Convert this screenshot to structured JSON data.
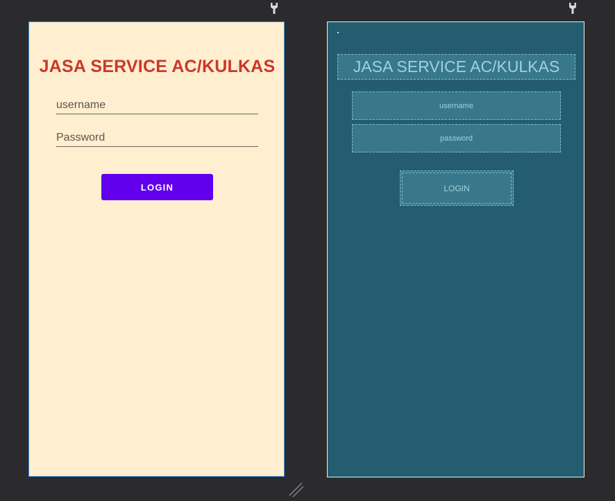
{
  "design_view": {
    "title": "JASA SERVICE AC/KULKAS",
    "username_hint": "username",
    "password_hint": "Password",
    "login_label": "LOGIN"
  },
  "blueprint_view": {
    "title": "JASA SERVICE AC/KULKAS",
    "username_hint": "username",
    "password_hint": "password",
    "login_label": "LOGIN"
  },
  "colors": {
    "canvas_bg": "#2b2b2d",
    "design_bg": "#ffeecf",
    "title_color": "#c8392b",
    "button_color": "#6200ee",
    "blueprint_bg": "#235d6f"
  },
  "icons": {
    "toolbar": "wrench-icon",
    "resize": "resize-handle-icon"
  }
}
